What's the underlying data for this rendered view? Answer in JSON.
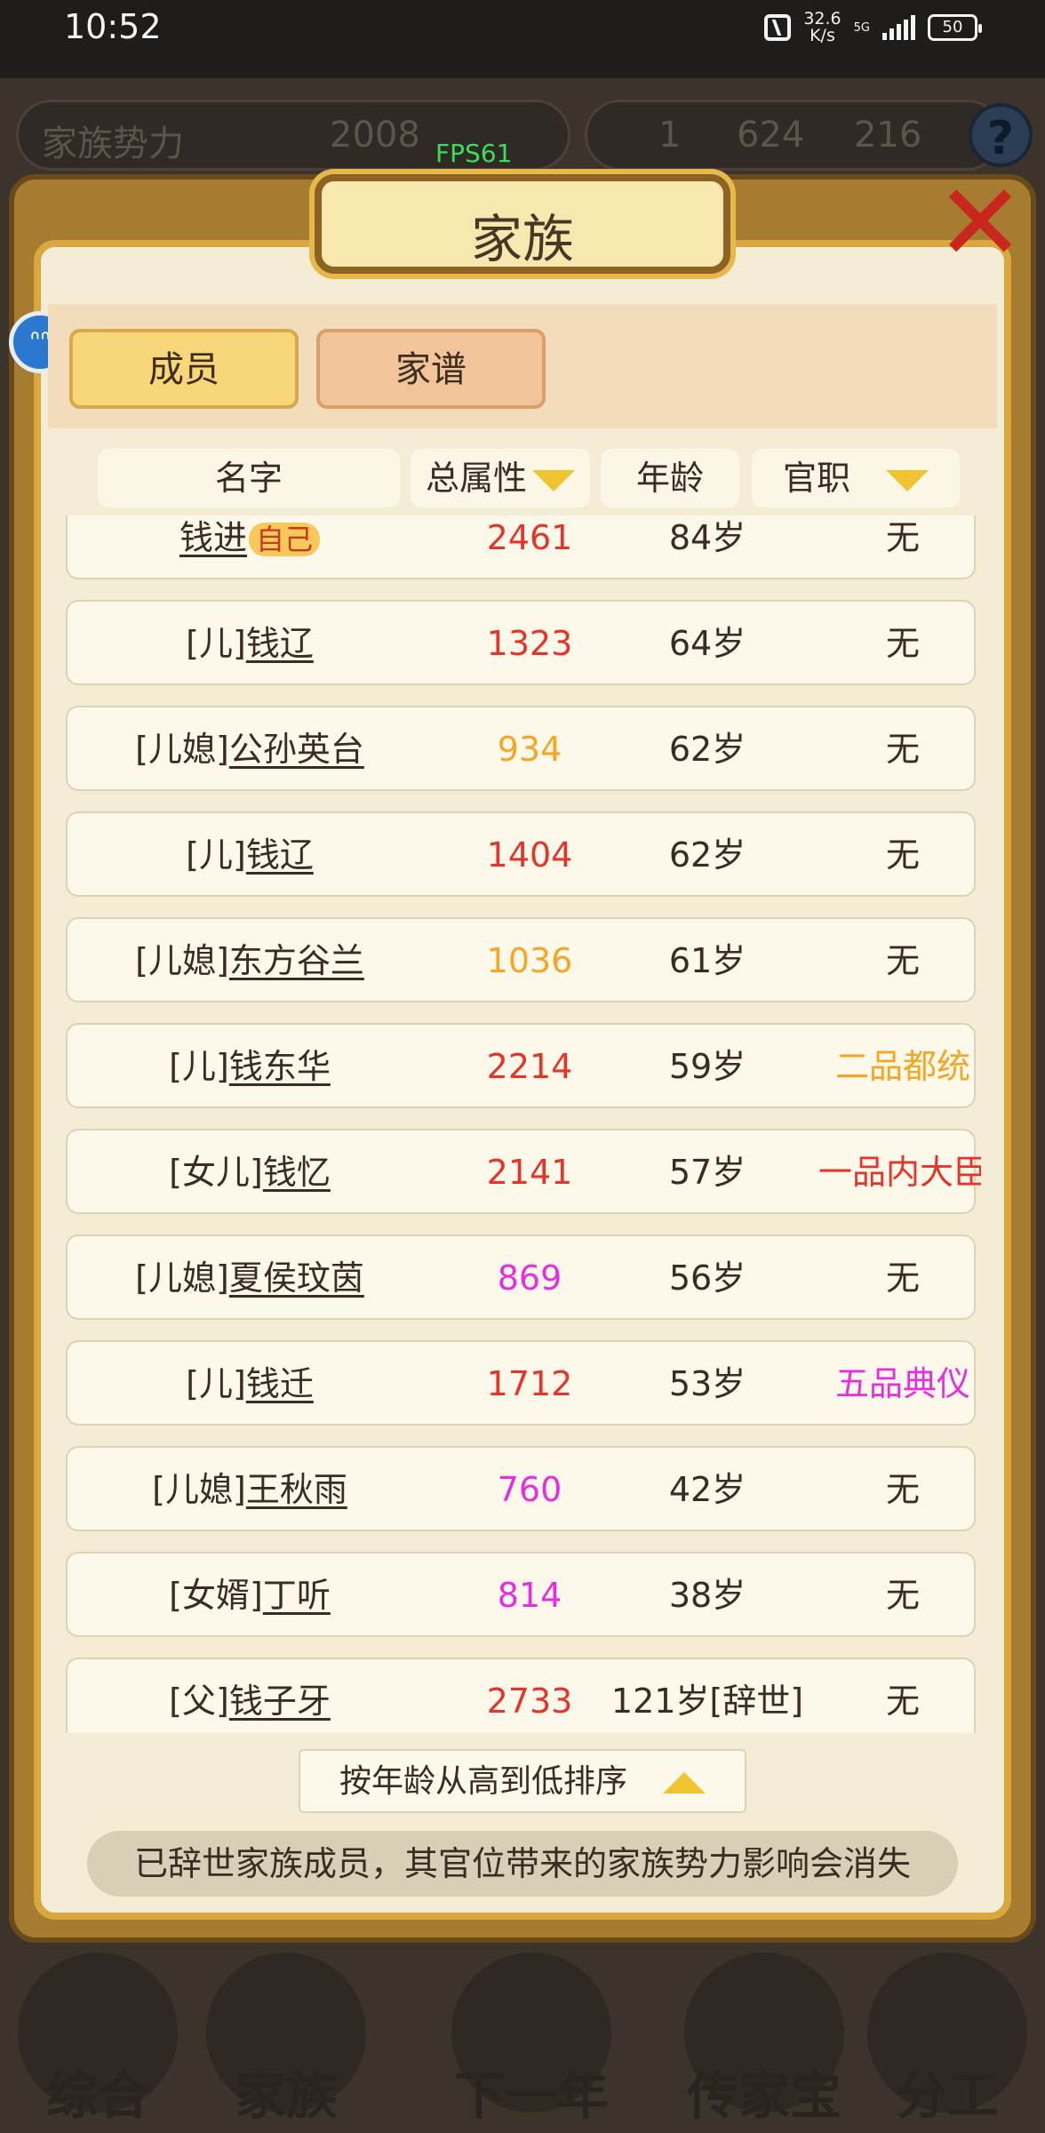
{
  "status_bar": {
    "time": "10:52",
    "net_speed_value": "32.6",
    "net_speed_unit": "K/s",
    "network_type": "5G",
    "battery": "50"
  },
  "top_bar": {
    "power_label": "家族势力",
    "power_value": "2008",
    "gold": "1",
    "silver": "624",
    "coins": "216",
    "help": "?"
  },
  "fps": "FPS61",
  "panel": {
    "title": "家族",
    "tabs": [
      "成员",
      "家谱"
    ]
  },
  "columns": {
    "name": "名字",
    "total_attr": "总属性",
    "age": "年龄",
    "office": "官职"
  },
  "colors": {
    "red": "#e4352a",
    "orange": "#f5a623",
    "magenta": "#e62ee0"
  },
  "members": [
    {
      "relation": "",
      "name": "钱进",
      "self_tag": "自己",
      "total": "2461",
      "total_color": "#e4352a",
      "age": "84岁",
      "office": "无",
      "office_color": "#3a2c22"
    },
    {
      "relation": "[儿]",
      "name": "钱辽",
      "self_tag": "",
      "total": "1323",
      "total_color": "#e4352a",
      "age": "64岁",
      "office": "无",
      "office_color": "#3a2c22"
    },
    {
      "relation": "[儿媳]",
      "name": "公孙英台",
      "self_tag": "",
      "total": "934",
      "total_color": "#f5a623",
      "age": "62岁",
      "office": "无",
      "office_color": "#3a2c22"
    },
    {
      "relation": "[儿]",
      "name": "钱辽",
      "self_tag": "",
      "total": "1404",
      "total_color": "#e4352a",
      "age": "62岁",
      "office": "无",
      "office_color": "#3a2c22"
    },
    {
      "relation": "[儿媳]",
      "name": "东方谷兰",
      "self_tag": "",
      "total": "1036",
      "total_color": "#f5a623",
      "age": "61岁",
      "office": "无",
      "office_color": "#3a2c22"
    },
    {
      "relation": "[儿]",
      "name": "钱东华",
      "self_tag": "",
      "total": "2214",
      "total_color": "#e4352a",
      "age": "59岁",
      "office": "二品都统",
      "office_color": "#f5a623"
    },
    {
      "relation": "[女儿]",
      "name": "钱忆",
      "self_tag": "",
      "total": "2141",
      "total_color": "#e4352a",
      "age": "57岁",
      "office": "一品内大臣",
      "office_color": "#e4352a"
    },
    {
      "relation": "[儿媳]",
      "name": "夏侯玟茵",
      "self_tag": "",
      "total": "869",
      "total_color": "#e62ee0",
      "age": "56岁",
      "office": "无",
      "office_color": "#3a2c22"
    },
    {
      "relation": "[儿]",
      "name": "钱迁",
      "self_tag": "",
      "total": "1712",
      "total_color": "#e4352a",
      "age": "53岁",
      "office": "五品典仪",
      "office_color": "#e62ee0"
    },
    {
      "relation": "[儿媳]",
      "name": "王秋雨",
      "self_tag": "",
      "total": "760",
      "total_color": "#e62ee0",
      "age": "42岁",
      "office": "无",
      "office_color": "#3a2c22"
    },
    {
      "relation": "[女婿]",
      "name": "丁听",
      "self_tag": "",
      "total": "814",
      "total_color": "#e62ee0",
      "age": "38岁",
      "office": "无",
      "office_color": "#3a2c22"
    },
    {
      "relation": "[父]",
      "name": "钱子牙",
      "self_tag": "",
      "total": "2733",
      "total_color": "#e4352a",
      "age": "121岁[辞世]",
      "office": "无",
      "office_color": "#3a2c22"
    }
  ],
  "sort_button": "按年龄从高到低排序",
  "notice": "已辞世家族成员，其官位带来的家族势力影响会消失",
  "bottom_nav": [
    "综合",
    "家族",
    "下一年",
    "传家宝",
    "分工"
  ]
}
